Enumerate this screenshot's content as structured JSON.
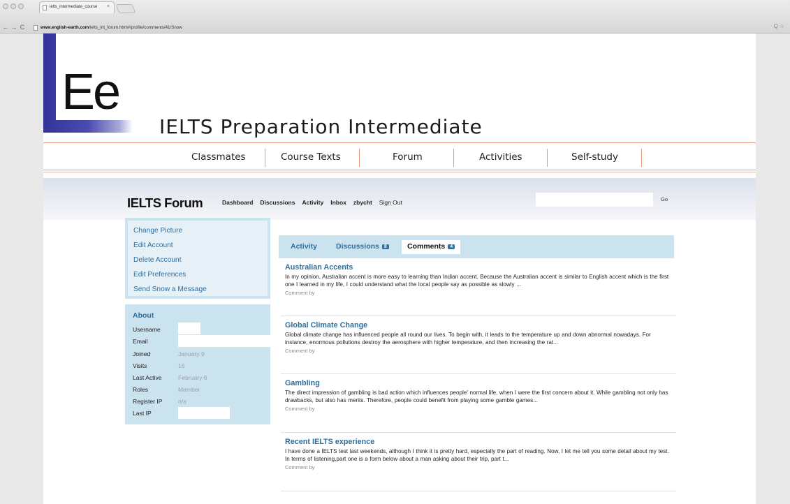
{
  "browser": {
    "tab_title": "ielts_intermediate_course",
    "tab_close": "×",
    "url_domain": "www.english-earth.com",
    "url_path": "/ielts_int_forum.html#/profile/comments/41/Snow",
    "back": "←",
    "forward": "→",
    "reload": "C",
    "toolbar_right": "Q☆"
  },
  "header": {
    "logo_text": "Ee",
    "site_title": "IELTS Preparation Intermediate",
    "nav": [
      "Classmates",
      "Course Texts",
      "Forum",
      "Activities",
      "Self-study"
    ]
  },
  "forum": {
    "title": "IELTS Forum",
    "links": [
      "Dashboard",
      "Discussions",
      "Activity",
      "Inbox",
      "zbycht"
    ],
    "sign_out": "Sign Out",
    "search_placeholder": "",
    "go_label": "Go"
  },
  "sidebar": {
    "menu": [
      "Change Picture",
      "Edit Account",
      "Delete Account",
      "Edit Preferences",
      "Send Snow a Message"
    ],
    "about_title": "About",
    "about_rows": [
      {
        "label": "Username",
        "value": ""
      },
      {
        "label": "Email",
        "value": ""
      },
      {
        "label": "Joined",
        "value": "January 9"
      },
      {
        "label": "Visits",
        "value": "16"
      },
      {
        "label": "Last Active",
        "value": "February 6"
      },
      {
        "label": "Roles",
        "value": "Member"
      },
      {
        "label": "Register IP",
        "value": "n/a"
      },
      {
        "label": "Last IP",
        "value": ""
      }
    ]
  },
  "tabs": [
    {
      "label": "Activity",
      "badge": ""
    },
    {
      "label": "Discussions",
      "badge": "8"
    },
    {
      "label": "Comments",
      "badge": "4"
    }
  ],
  "comments": [
    {
      "title": "Australian Accents",
      "body": "In my opinion, Australian accent is more easy to learning than Indian accent. Because the Australian accent is similar to English accent which is the first one I learned in my life, I could understand what the local people say as possible as slowly ...",
      "by": "Comment by"
    },
    {
      "title": "Global Climate Change",
      "body": "Global climate change has influenced people all round our lives. To begin with, it leads to the temperature up and down abnormal nowadays. For instance, enormous  pollutions destroy the aerosphere with higher temperature, and then increasing the rat...",
      "by": "Comment by"
    },
    {
      "title": "Gambling",
      "body": "The direct impression of gambling is bad action which influences people' normal life, when I were the first concern about it. While gambling  not only has drawbacks, but also has merits. Therefore, people could benefit from playing some gamble games...",
      "by": "Comment by"
    },
    {
      "title": "Recent IELTS experience",
      "body": "I  have done a IELTS test last weekends, although I think it is pretty hard, especially the part of reading. Now, I let me tell you some detail about my test. In terms of listening,part one is a form below about a man asking about their trip, part t...",
      "by": "Comment by"
    }
  ]
}
